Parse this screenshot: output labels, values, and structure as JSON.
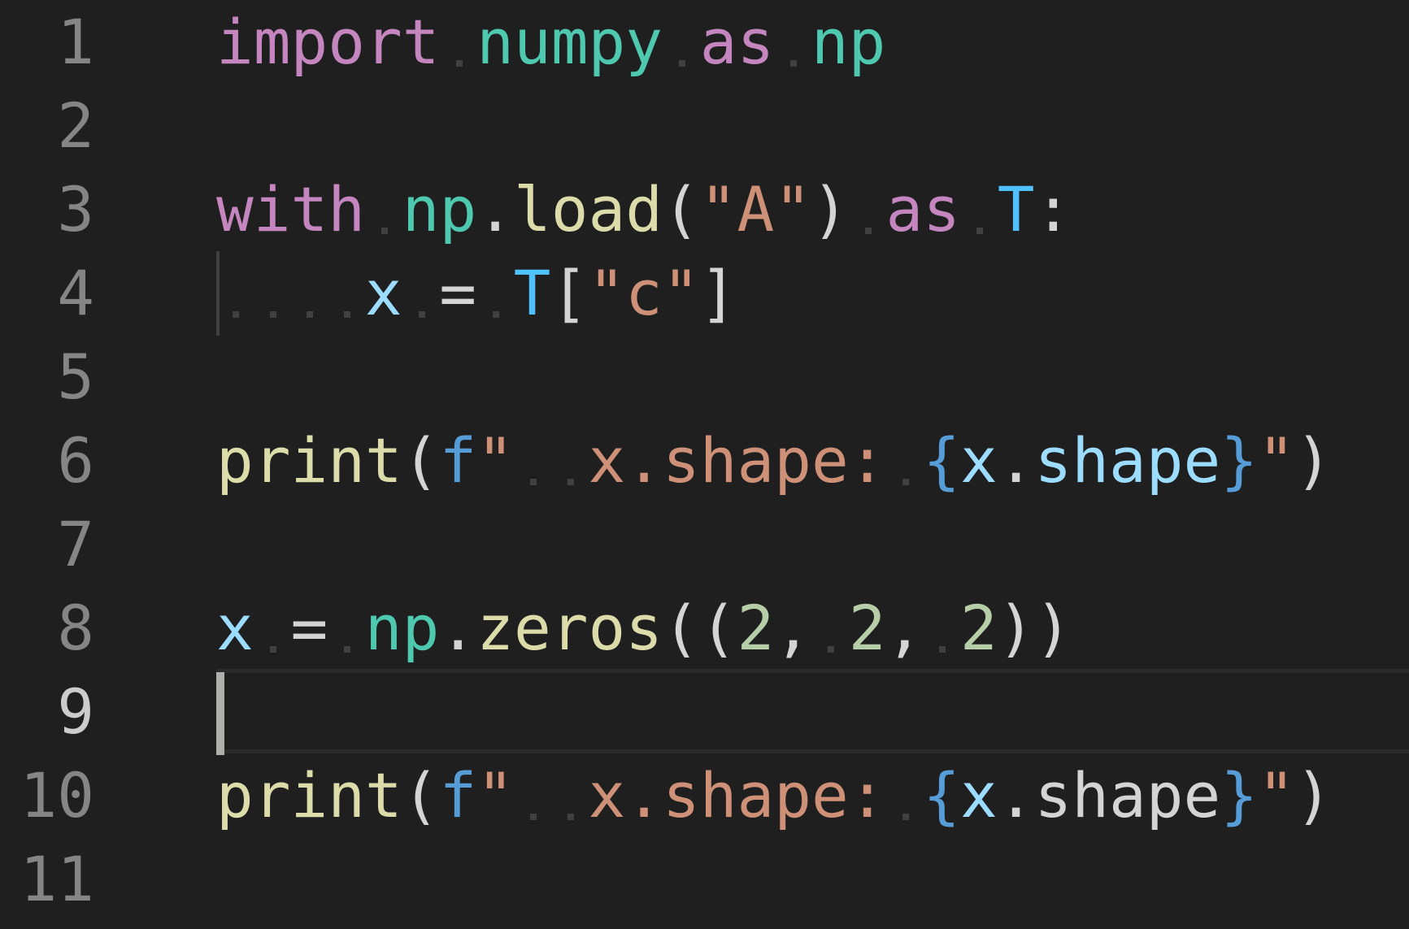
{
  "editor": {
    "language": "python",
    "cursor_line": 9,
    "lines": [
      {
        "number": "1",
        "text": "import numpy as np"
      },
      {
        "number": "2",
        "text": ""
      },
      {
        "number": "3",
        "text": "with np.load(\"A\") as T:"
      },
      {
        "number": "4",
        "text": "    x = T[\"c\"]"
      },
      {
        "number": "5",
        "text": ""
      },
      {
        "number": "6",
        "text": "print(f\"  x.shape: {x.shape}\")"
      },
      {
        "number": "7",
        "text": ""
      },
      {
        "number": "8",
        "text": "x = np.zeros((2, 2, 2))"
      },
      {
        "number": "9",
        "text": ""
      },
      {
        "number": "10",
        "text": "print(f\"  x.shape: {x.shape}\")"
      },
      {
        "number": "11",
        "text": ""
      }
    ]
  },
  "colors": {
    "background": "#1f1f1f",
    "keyword": "#c586c0",
    "module": "#4ec9b0",
    "function": "#dcdcaa",
    "string": "#ce9178",
    "variable": "#9cdcfe",
    "constant": "#4fc1ff",
    "number": "#b5cea8",
    "line_number": "#858585",
    "line_number_active": "#cccccc"
  }
}
